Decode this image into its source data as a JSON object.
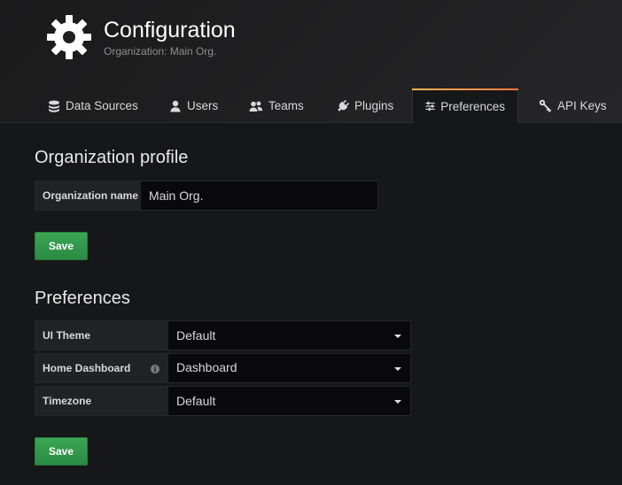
{
  "header": {
    "title": "Configuration",
    "subtitle": "Organization: Main Org.",
    "icon": "gear-icon"
  },
  "tabs": [
    {
      "label": "Data Sources",
      "icon": "database-icon",
      "active": false
    },
    {
      "label": "Users",
      "icon": "user-icon",
      "active": false
    },
    {
      "label": "Teams",
      "icon": "users-icon",
      "active": false
    },
    {
      "label": "Plugins",
      "icon": "plug-icon",
      "active": false
    },
    {
      "label": "Preferences",
      "icon": "sliders-icon",
      "active": true
    },
    {
      "label": "API Keys",
      "icon": "key-icon",
      "active": false
    }
  ],
  "org_profile": {
    "heading": "Organization profile",
    "name_label": "Organization name",
    "name_value": "Main Org.",
    "save_label": "Save"
  },
  "preferences": {
    "heading": "Preferences",
    "ui_theme_label": "UI Theme",
    "ui_theme_value": "Default",
    "home_dashboard_label": "Home Dashboard",
    "home_dashboard_value": "Dashboard",
    "timezone_label": "Timezone",
    "timezone_value": "Default",
    "save_label": "Save"
  },
  "colors": {
    "accent_gradient_start": "#ffb357",
    "accent_gradient_end": "#ff7941",
    "button_green": "#34984e",
    "background": "#161719"
  }
}
